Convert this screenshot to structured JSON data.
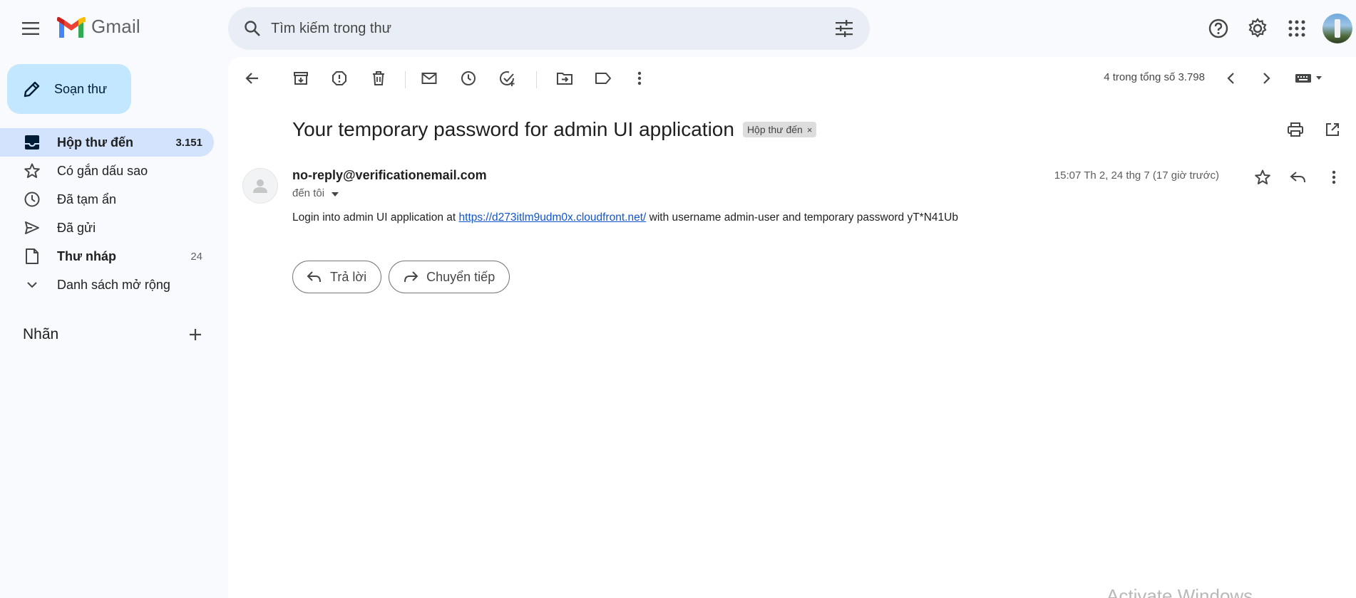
{
  "app": {
    "name": "Gmail"
  },
  "search": {
    "placeholder": "Tìm kiếm trong thư"
  },
  "compose": {
    "label": "Soạn thư"
  },
  "sidebar": {
    "items": [
      {
        "label": "Hộp thư đến",
        "count": "3.151",
        "icon": "inbox-icon"
      },
      {
        "label": "Có gắn dấu sao",
        "count": "",
        "icon": "star-icon"
      },
      {
        "label": "Đã tạm ẩn",
        "count": "",
        "icon": "clock-icon"
      },
      {
        "label": "Đã gửi",
        "count": "",
        "icon": "send-icon"
      },
      {
        "label": "Thư nháp",
        "count": "24",
        "icon": "draft-icon"
      },
      {
        "label": "Danh sách mở rộng",
        "count": "",
        "icon": "chevron-down-icon"
      }
    ],
    "labels_title": "Nhãn"
  },
  "toolbar": {
    "pager": "4 trong tổng số 3.798"
  },
  "message": {
    "subject": "Your temporary password for admin UI application",
    "tag": "Hộp thư đến",
    "tag_close": "×",
    "sender": "no-reply@verificationemail.com",
    "to": "đến tôi",
    "date": "15:07 Th 2, 24 thg 7 (17 giờ trước)",
    "body_pre": "Login into admin UI application at ",
    "body_link": "https://d273itlm9udm0x.cloudfront.net/",
    "body_post": " with username admin-user and temporary password yT*N41Ub"
  },
  "actions": {
    "reply": "Trả lời",
    "forward": "Chuyển tiếp"
  },
  "watermark": "Activate Windows",
  "colors": {
    "accent": "#c2e7ff",
    "active_nav": "#d3e3fd",
    "link": "#1155cc",
    "search_bg": "#e9eef6"
  }
}
